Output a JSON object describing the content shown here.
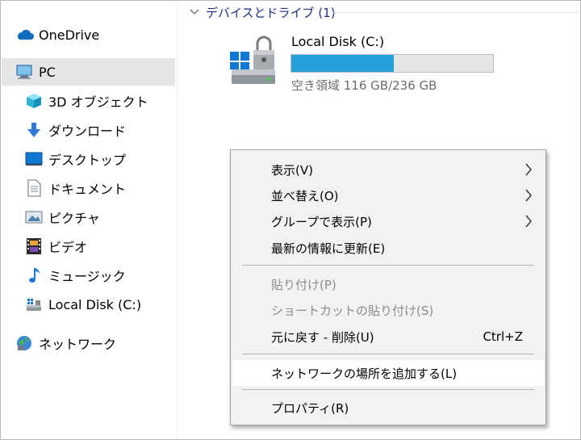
{
  "sidebar": {
    "items": [
      {
        "label": "OneDrive",
        "icon": "cloud-icon"
      },
      {
        "label": "PC",
        "icon": "computer-icon",
        "selected": true
      },
      {
        "label": "3D オブジェクト",
        "icon": "3d-objects-icon"
      },
      {
        "label": "ダウンロード",
        "icon": "download-arrow-icon"
      },
      {
        "label": "デスクトップ",
        "icon": "desktop-icon"
      },
      {
        "label": "ドキュメント",
        "icon": "document-icon"
      },
      {
        "label": "ピクチャ",
        "icon": "pictures-icon"
      },
      {
        "label": "ビデオ",
        "icon": "video-icon"
      },
      {
        "label": "ミュージック",
        "icon": "music-note-icon"
      },
      {
        "label": "Local Disk (C:)",
        "icon": "drive-icon"
      },
      {
        "label": "ネットワーク",
        "icon": "network-icon"
      }
    ]
  },
  "main": {
    "group_header": "デバイスとドライブ (1)",
    "drive": {
      "name": "Local Disk (C:)",
      "free_text": "空き領域 116 GB/236 GB",
      "used_fraction": 0.508,
      "bar_color": "#26a0da"
    }
  },
  "context_menu": {
    "items": [
      {
        "label": "表示(V)",
        "submenu": true
      },
      {
        "label": "並べ替え(O)",
        "submenu": true
      },
      {
        "label": "グループで表示(P)",
        "submenu": true
      },
      {
        "label": "最新の情報に更新(E)"
      },
      {
        "label": "貼り付け(P)",
        "disabled": true
      },
      {
        "label": "ショートカットの貼り付け(S)",
        "disabled": true
      },
      {
        "label": "元に戻す - 削除(U)",
        "shortcut": "Ctrl+Z"
      },
      {
        "label": "ネットワークの場所を追加する(L)",
        "highlighted": true
      },
      {
        "label": "プロパティ(R)"
      }
    ]
  }
}
